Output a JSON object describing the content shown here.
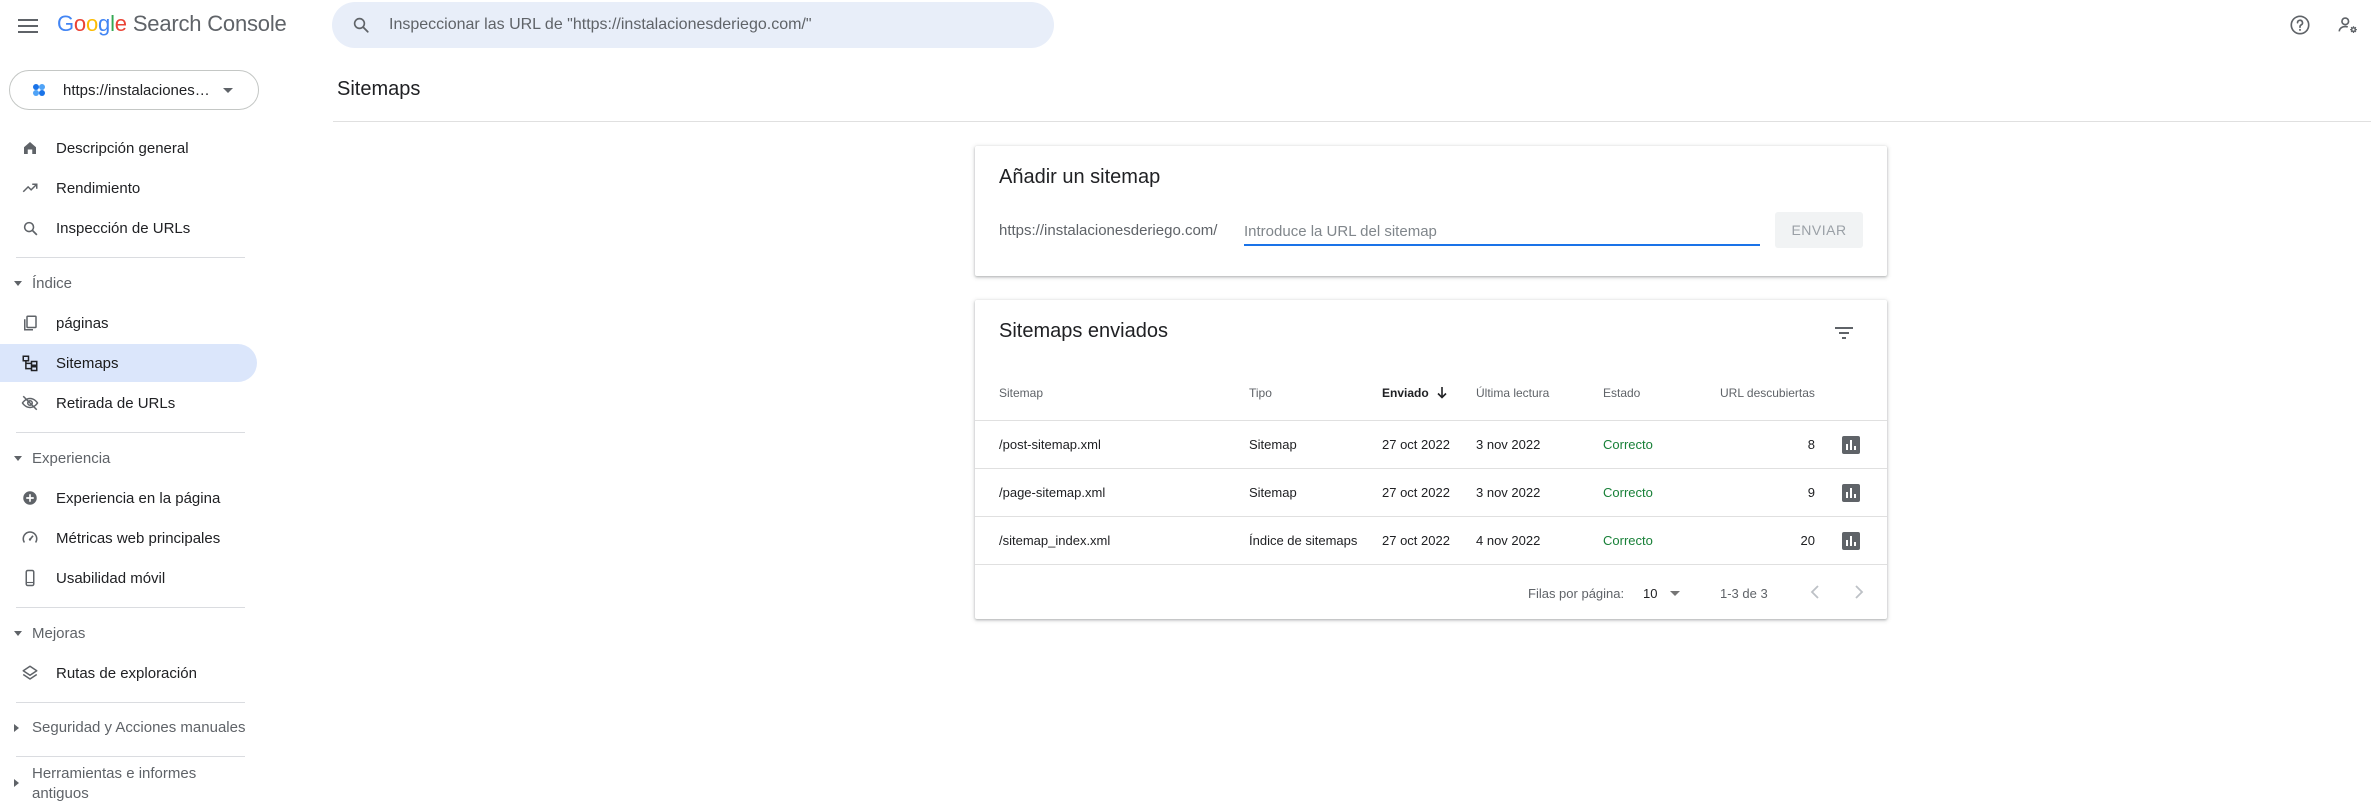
{
  "header": {
    "logo_letters": [
      {
        "ch": "G",
        "color": "#4285F4"
      },
      {
        "ch": "o",
        "color": "#EA4335"
      },
      {
        "ch": "o",
        "color": "#FBBC05"
      },
      {
        "ch": "g",
        "color": "#4285F4"
      },
      {
        "ch": "l",
        "color": "#34A853"
      },
      {
        "ch": "e",
        "color": "#EA4335"
      }
    ],
    "product": "Search Console",
    "search_placeholder": "Inspeccionar las URL de \"https://instalacionesderiego.com/\""
  },
  "sidebar": {
    "property": "https://instalacionesderiego.com/",
    "items": [
      {
        "label": "Descripción general",
        "icon": "home-icon"
      },
      {
        "label": "Rendimiento",
        "icon": "trending-up-icon"
      },
      {
        "label": "Inspección de URLs",
        "icon": "search-icon"
      }
    ],
    "sections": [
      {
        "label": "Índice",
        "expanded": true,
        "items": [
          {
            "label": "páginas",
            "icon": "pages-icon"
          },
          {
            "label": "Sitemaps",
            "icon": "sitemap-icon",
            "active": true
          },
          {
            "label": "Retirada de URLs",
            "icon": "removals-icon"
          }
        ]
      },
      {
        "label": "Experiencia",
        "expanded": true,
        "items": [
          {
            "label": "Experiencia en la página",
            "icon": "page-experience-icon"
          },
          {
            "label": "Métricas web principales",
            "icon": "speed-icon"
          },
          {
            "label": "Usabilidad móvil",
            "icon": "mobile-icon"
          }
        ]
      },
      {
        "label": "Mejoras",
        "expanded": true,
        "items": [
          {
            "label": "Rutas de exploración",
            "icon": "layers-icon"
          }
        ]
      },
      {
        "label": "Seguridad y Acciones manuales",
        "expanded": false,
        "items": []
      },
      {
        "label": "Herramientas e informes antiguos",
        "expanded": false,
        "items": []
      }
    ]
  },
  "main": {
    "title": "Sitemaps",
    "add_card": {
      "title": "Añadir un sitemap",
      "prefix": "https://instalacionesderiego.com/",
      "input_placeholder": "Introduce la URL del sitemap",
      "input_value": "",
      "submit_label": "ENVIAR"
    },
    "list_card": {
      "title": "Sitemaps enviados",
      "columns": [
        "Sitemap",
        "Tipo",
        "Enviado",
        "Última lectura",
        "Estado",
        "URL descubiertas"
      ],
      "sorted_column": "Enviado",
      "rows": [
        {
          "sitemap": "/post-sitemap.xml",
          "type": "Sitemap",
          "submitted": "27 oct 2022",
          "last_read": "3 nov 2022",
          "status": "Correcto",
          "urls": "8"
        },
        {
          "sitemap": "/page-sitemap.xml",
          "type": "Sitemap",
          "submitted": "27 oct 2022",
          "last_read": "3 nov 2022",
          "status": "Correcto",
          "urls": "9"
        },
        {
          "sitemap": "/sitemap_index.xml",
          "type": "Índice de sitemaps",
          "submitted": "27 oct 2022",
          "last_read": "4 nov 2022",
          "status": "Correcto",
          "urls": "20"
        }
      ],
      "pagination": {
        "rows_label": "Filas por página:",
        "rows_per_page": "10",
        "range": "1-3 de 3"
      }
    }
  },
  "colors": {
    "accent": "#1a73e8",
    "active_nav": "#dbe6fb",
    "status_ok": "#188038",
    "search_bg": "#e8eef9"
  }
}
